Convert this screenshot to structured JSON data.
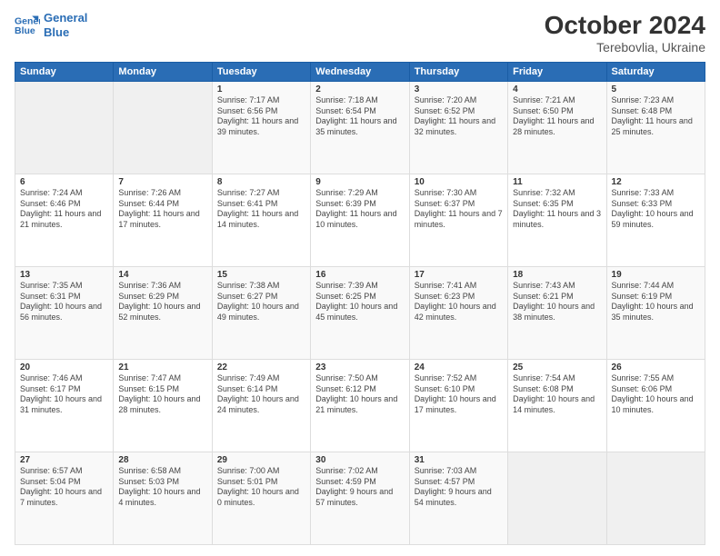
{
  "header": {
    "logo_line1": "General",
    "logo_line2": "Blue",
    "month": "October 2024",
    "location": "Terebovlia, Ukraine"
  },
  "weekdays": [
    "Sunday",
    "Monday",
    "Tuesday",
    "Wednesday",
    "Thursday",
    "Friday",
    "Saturday"
  ],
  "weeks": [
    [
      {
        "day": "",
        "content": ""
      },
      {
        "day": "",
        "content": ""
      },
      {
        "day": "1",
        "content": "Sunrise: 7:17 AM\nSunset: 6:56 PM\nDaylight: 11 hours and 39 minutes."
      },
      {
        "day": "2",
        "content": "Sunrise: 7:18 AM\nSunset: 6:54 PM\nDaylight: 11 hours and 35 minutes."
      },
      {
        "day": "3",
        "content": "Sunrise: 7:20 AM\nSunset: 6:52 PM\nDaylight: 11 hours and 32 minutes."
      },
      {
        "day": "4",
        "content": "Sunrise: 7:21 AM\nSunset: 6:50 PM\nDaylight: 11 hours and 28 minutes."
      },
      {
        "day": "5",
        "content": "Sunrise: 7:23 AM\nSunset: 6:48 PM\nDaylight: 11 hours and 25 minutes."
      }
    ],
    [
      {
        "day": "6",
        "content": "Sunrise: 7:24 AM\nSunset: 6:46 PM\nDaylight: 11 hours and 21 minutes."
      },
      {
        "day": "7",
        "content": "Sunrise: 7:26 AM\nSunset: 6:44 PM\nDaylight: 11 hours and 17 minutes."
      },
      {
        "day": "8",
        "content": "Sunrise: 7:27 AM\nSunset: 6:41 PM\nDaylight: 11 hours and 14 minutes."
      },
      {
        "day": "9",
        "content": "Sunrise: 7:29 AM\nSunset: 6:39 PM\nDaylight: 11 hours and 10 minutes."
      },
      {
        "day": "10",
        "content": "Sunrise: 7:30 AM\nSunset: 6:37 PM\nDaylight: 11 hours and 7 minutes."
      },
      {
        "day": "11",
        "content": "Sunrise: 7:32 AM\nSunset: 6:35 PM\nDaylight: 11 hours and 3 minutes."
      },
      {
        "day": "12",
        "content": "Sunrise: 7:33 AM\nSunset: 6:33 PM\nDaylight: 10 hours and 59 minutes."
      }
    ],
    [
      {
        "day": "13",
        "content": "Sunrise: 7:35 AM\nSunset: 6:31 PM\nDaylight: 10 hours and 56 minutes."
      },
      {
        "day": "14",
        "content": "Sunrise: 7:36 AM\nSunset: 6:29 PM\nDaylight: 10 hours and 52 minutes."
      },
      {
        "day": "15",
        "content": "Sunrise: 7:38 AM\nSunset: 6:27 PM\nDaylight: 10 hours and 49 minutes."
      },
      {
        "day": "16",
        "content": "Sunrise: 7:39 AM\nSunset: 6:25 PM\nDaylight: 10 hours and 45 minutes."
      },
      {
        "day": "17",
        "content": "Sunrise: 7:41 AM\nSunset: 6:23 PM\nDaylight: 10 hours and 42 minutes."
      },
      {
        "day": "18",
        "content": "Sunrise: 7:43 AM\nSunset: 6:21 PM\nDaylight: 10 hours and 38 minutes."
      },
      {
        "day": "19",
        "content": "Sunrise: 7:44 AM\nSunset: 6:19 PM\nDaylight: 10 hours and 35 minutes."
      }
    ],
    [
      {
        "day": "20",
        "content": "Sunrise: 7:46 AM\nSunset: 6:17 PM\nDaylight: 10 hours and 31 minutes."
      },
      {
        "day": "21",
        "content": "Sunrise: 7:47 AM\nSunset: 6:15 PM\nDaylight: 10 hours and 28 minutes."
      },
      {
        "day": "22",
        "content": "Sunrise: 7:49 AM\nSunset: 6:14 PM\nDaylight: 10 hours and 24 minutes."
      },
      {
        "day": "23",
        "content": "Sunrise: 7:50 AM\nSunset: 6:12 PM\nDaylight: 10 hours and 21 minutes."
      },
      {
        "day": "24",
        "content": "Sunrise: 7:52 AM\nSunset: 6:10 PM\nDaylight: 10 hours and 17 minutes."
      },
      {
        "day": "25",
        "content": "Sunrise: 7:54 AM\nSunset: 6:08 PM\nDaylight: 10 hours and 14 minutes."
      },
      {
        "day": "26",
        "content": "Sunrise: 7:55 AM\nSunset: 6:06 PM\nDaylight: 10 hours and 10 minutes."
      }
    ],
    [
      {
        "day": "27",
        "content": "Sunrise: 6:57 AM\nSunset: 5:04 PM\nDaylight: 10 hours and 7 minutes."
      },
      {
        "day": "28",
        "content": "Sunrise: 6:58 AM\nSunset: 5:03 PM\nDaylight: 10 hours and 4 minutes."
      },
      {
        "day": "29",
        "content": "Sunrise: 7:00 AM\nSunset: 5:01 PM\nDaylight: 10 hours and 0 minutes."
      },
      {
        "day": "30",
        "content": "Sunrise: 7:02 AM\nSunset: 4:59 PM\nDaylight: 9 hours and 57 minutes."
      },
      {
        "day": "31",
        "content": "Sunrise: 7:03 AM\nSunset: 4:57 PM\nDaylight: 9 hours and 54 minutes."
      },
      {
        "day": "",
        "content": ""
      },
      {
        "day": "",
        "content": ""
      }
    ]
  ]
}
